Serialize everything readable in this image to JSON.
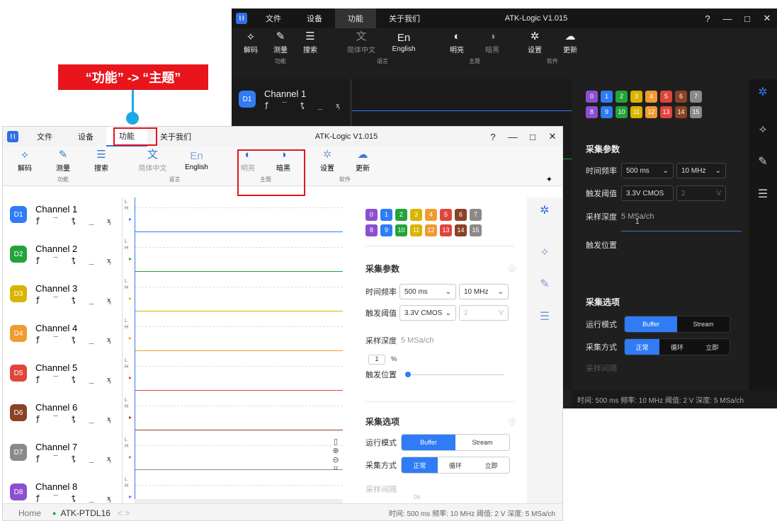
{
  "app": {
    "title": "ATK-Logic  V1.015",
    "window_controls": [
      "?",
      "—",
      "□",
      "✕"
    ]
  },
  "menu": [
    "文件",
    "设备",
    "功能",
    "关于我们"
  ],
  "ribbon": {
    "groups": [
      {
        "label": "功能",
        "buttons": [
          {
            "label": "解码",
            "icon": "decode-icon"
          },
          {
            "label": "测量",
            "icon": "measure-icon"
          },
          {
            "label": "搜索",
            "icon": "search-icon"
          }
        ]
      },
      {
        "label": "语言",
        "buttons": [
          {
            "label": "简体中文",
            "icon": "chinese-icon"
          },
          {
            "label": "English",
            "icon": "english-icon"
          }
        ]
      },
      {
        "label": "主题",
        "buttons": [
          {
            "label": "明亮",
            "icon": "light-theme-icon"
          },
          {
            "label": "暗黑",
            "icon": "dark-theme-icon"
          }
        ]
      },
      {
        "label": "软件",
        "buttons": [
          {
            "label": "设置",
            "icon": "gear-icon"
          },
          {
            "label": "更新",
            "icon": "cloud-update-icon"
          }
        ]
      }
    ]
  },
  "callout": "“功能” -> “主题”",
  "channels": [
    {
      "badge": "D1",
      "name": "Channel 1",
      "color": "#2f7cf6"
    },
    {
      "badge": "D2",
      "name": "Channel 2",
      "color": "#23a33b"
    },
    {
      "badge": "D3",
      "name": "Channel 3",
      "color": "#d9b400"
    },
    {
      "badge": "D4",
      "name": "Channel 4",
      "color": "#f09a2f"
    },
    {
      "badge": "D5",
      "name": "Channel 5",
      "color": "#e0453c"
    },
    {
      "badge": "D6",
      "name": "Channel 6",
      "color": "#8b4226"
    },
    {
      "badge": "D7",
      "name": "Channel 7",
      "color": "#8a8a8a"
    },
    {
      "badge": "D8",
      "name": "Channel 8",
      "color": "#8d4fd2"
    }
  ],
  "channel_symbols": "ƒ ‾ ƫ _ ᶍ",
  "level_labels": {
    "low": "L",
    "high": "H"
  },
  "channel_numbers": [
    {
      "n": "0",
      "c": "#8d4fd2"
    },
    {
      "n": "1",
      "c": "#2f7cf6"
    },
    {
      "n": "2",
      "c": "#23a33b"
    },
    {
      "n": "3",
      "c": "#d9b400"
    },
    {
      "n": "4",
      "c": "#f09a2f"
    },
    {
      "n": "5",
      "c": "#e0453c"
    },
    {
      "n": "6",
      "c": "#8b4226"
    },
    {
      "n": "7",
      "c": "#8a8a8a"
    },
    {
      "n": "8",
      "c": "#8d4fd2"
    },
    {
      "n": "9",
      "c": "#2f7cf6"
    },
    {
      "n": "10",
      "c": "#23a33b"
    },
    {
      "n": "11",
      "c": "#d9b400"
    },
    {
      "n": "12",
      "c": "#f09a2f"
    },
    {
      "n": "13",
      "c": "#e0453c"
    },
    {
      "n": "14",
      "c": "#8b4226"
    },
    {
      "n": "15",
      "c": "#8a8a8a"
    }
  ],
  "acq": {
    "title": "采集参数",
    "time_label": "时间频率",
    "time_value": "500 ms",
    "freq_value": "10 MHz",
    "threshold_label": "触发阈值",
    "threshold_value": "3.3V CMOS",
    "threshold_num": "2",
    "threshold_unit": "V",
    "depth_label": "采样深度",
    "depth_value": "5 MSa/ch",
    "trigger_pos_label": "触发位置",
    "trigger_pos_value": "1",
    "trigger_pos_unit": "%"
  },
  "opts": {
    "title": "采集选项",
    "run_mode_label": "运行模式",
    "run_modes": [
      "Buffer",
      "Stream"
    ],
    "acq_mode_label": "采集方式",
    "acq_modes": [
      "正常",
      "循环",
      "立即"
    ],
    "interval_label": "采样间隔",
    "interval_value": "0s"
  },
  "status": {
    "home": "Home",
    "device": "ATK-PTDL16",
    "nav": "< >",
    "info": "时间: 500 ms  频率: 10 MHz  阈值: 2 V  深度: 5 MSa/ch"
  }
}
